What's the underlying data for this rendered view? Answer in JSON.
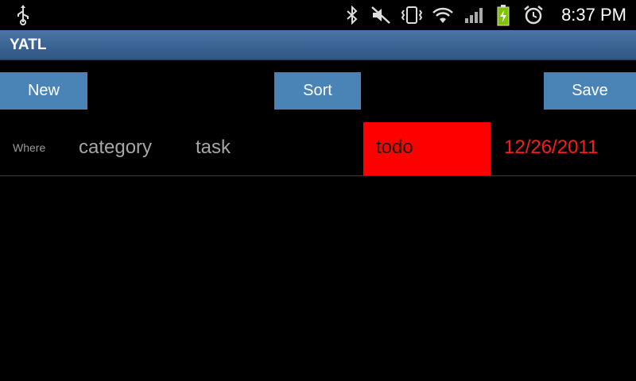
{
  "statusbar": {
    "time": "8:37 PM",
    "icons": [
      "usb-icon",
      "bluetooth-icon",
      "mute-icon",
      "vibrate-icon",
      "wifi-icon",
      "signal-icon",
      "battery-charging-icon",
      "alarm-icon"
    ]
  },
  "titlebar": {
    "title": "YATL"
  },
  "toolbar": {
    "new_label": "New",
    "sort_label": "Sort",
    "save_label": "Save"
  },
  "tasks": [
    {
      "where": "Where",
      "category": "category",
      "task": "task",
      "status": "todo",
      "date": "12/26/2011"
    }
  ],
  "colors": {
    "titlebar": "#3a6494",
    "button": "#4a84b7",
    "status_todo": "#ff0000",
    "date": "#ff1a1a"
  }
}
